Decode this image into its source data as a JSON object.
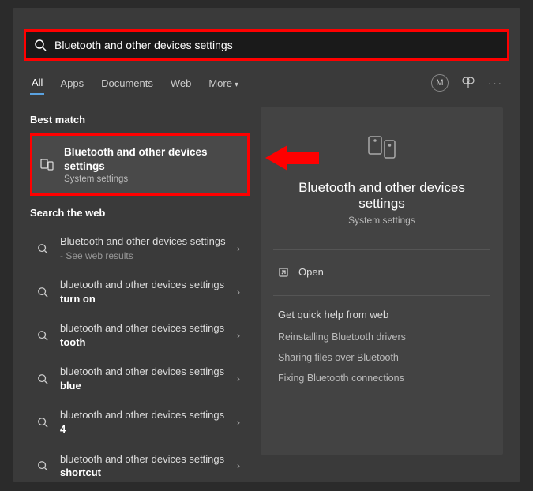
{
  "search": {
    "query": "Bluetooth and other devices settings"
  },
  "tabs": {
    "items": [
      "All",
      "Apps",
      "Documents",
      "Web",
      "More"
    ],
    "active": 0
  },
  "user": {
    "initial": "M"
  },
  "left": {
    "bestMatchHeader": "Best match",
    "bestMatch": {
      "title": "Bluetooth and other devices settings",
      "subtitle": "System settings"
    },
    "webHeader": "Search the web",
    "webResults": [
      {
        "prefix": "Bluetooth and other devices settings",
        "bold": "",
        "suffix": " - See web results"
      },
      {
        "prefix": "bluetooth and other devices settings ",
        "bold": "turn on",
        "suffix": ""
      },
      {
        "prefix": "bluetooth and other devices settings ",
        "bold": "tooth",
        "suffix": ""
      },
      {
        "prefix": "bluetooth and other devices settings ",
        "bold": "blue",
        "suffix": ""
      },
      {
        "prefix": "bluetooth and other devices settings ",
        "bold": "4",
        "suffix": ""
      },
      {
        "prefix": "bluetooth and other devices settings ",
        "bold": "shortcut",
        "suffix": ""
      }
    ]
  },
  "preview": {
    "title": "Bluetooth and other devices settings",
    "subtitle": "System settings",
    "openLabel": "Open",
    "helpHeader": "Get quick help from web",
    "helpLinks": [
      "Reinstalling Bluetooth drivers",
      "Sharing files over Bluetooth",
      "Fixing Bluetooth connections"
    ]
  }
}
